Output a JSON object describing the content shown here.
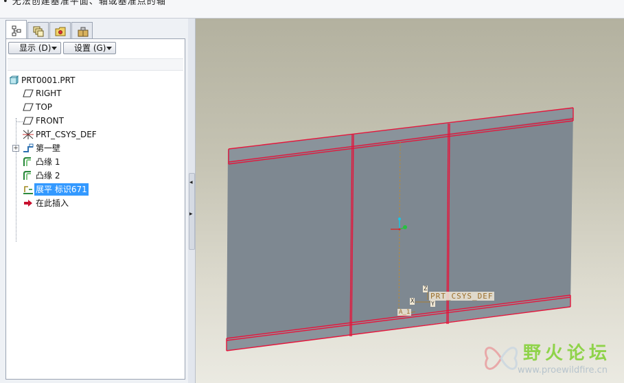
{
  "status_message": "• 无法创建基准平面、轴或基准点的轴",
  "buttons": {
    "display_label": "显示 (D)",
    "settings_label": "设置 (G)"
  },
  "tabs": [
    {
      "name": "model-tree-tab",
      "icon": "model-tree-icon",
      "active": true
    },
    {
      "name": "layers-tab",
      "icon": "layers-icon",
      "active": false
    },
    {
      "name": "favorites-tab",
      "icon": "favorites-folder-icon",
      "active": false
    },
    {
      "name": "tools-tab",
      "icon": "tools-icon",
      "active": false
    }
  ],
  "tree": {
    "root": "PRT0001.PRT",
    "items": [
      {
        "label": "RIGHT",
        "icon": "datum-plane-icon"
      },
      {
        "label": "TOP",
        "icon": "datum-plane-icon"
      },
      {
        "label": "FRONT",
        "icon": "datum-plane-icon"
      },
      {
        "label": "PRT_CSYS_DEF",
        "icon": "csys-icon"
      },
      {
        "label": "第一壁",
        "icon": "first-wall-icon"
      },
      {
        "label": "凸缘 1",
        "icon": "flange-icon"
      },
      {
        "label": "凸缘 2",
        "icon": "flange-icon"
      },
      {
        "label": "展平 标识671",
        "icon": "unbend-icon",
        "selected": true
      },
      {
        "label": "在此插入",
        "icon": "insert-here-arrow-icon"
      }
    ]
  },
  "viewport": {
    "csys_label": "PRT_CSYS_DEF",
    "axis_labels": {
      "z": "Z",
      "x": "X",
      "y": "Y",
      "a": "A_1"
    },
    "colors": {
      "sheet": "#7e8891",
      "edge": "#e4163c",
      "datum": "#b58a3c"
    }
  },
  "watermark": {
    "text": "野火论坛",
    "url": "www.proewildfire.cn"
  }
}
